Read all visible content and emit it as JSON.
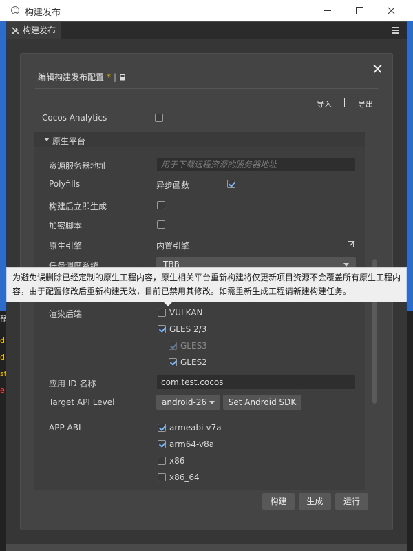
{
  "window": {
    "title": "构建发布",
    "tab_label": "构建发布"
  },
  "background_peek": {
    "left": [
      "d",
      "d",
      "st",
      "e"
    ],
    "left_top_char": "琵",
    "right_top_char": "a"
  },
  "dialog": {
    "title": "编辑构建发布配置",
    "modified_marker": "*",
    "separator": "|",
    "import_label": "导入",
    "export_label": "导出"
  },
  "cocos_analytics": {
    "label": "Cocos Analytics",
    "checked": false
  },
  "native_section": {
    "title": "原生平台",
    "resource_server": {
      "label": "资源服务器地址",
      "placeholder": "用于下载远程资源的服务器地址"
    },
    "polyfills": {
      "label": "Polyfills",
      "option_label": "异步函数",
      "checked": true
    },
    "build_immediately": {
      "label": "构建后立即生成",
      "checked": false
    },
    "encrypt_script": {
      "label": "加密脚本",
      "checked": false
    },
    "native_engine": {
      "label": "原生引擎",
      "value": "内置引擎"
    },
    "task_scheduler": {
      "label": "任务调度系统",
      "value": "TBB"
    },
    "render_backend": {
      "label": "渲染后端",
      "options": [
        {
          "label": "VULKAN",
          "checked": false
        },
        {
          "label": "GLES 2/3",
          "checked": true
        },
        {
          "label": "GLES3",
          "checked": true,
          "disabled": true
        },
        {
          "label": "GLES2",
          "checked": true
        }
      ]
    },
    "app_id": {
      "label": "应用 ID 名称",
      "value": "com.test.cocos"
    },
    "target_api": {
      "label": "Target API Level",
      "value": "android-26",
      "sdk_button": "Set Android SDK"
    },
    "app_abi": {
      "label": "APP ABI",
      "options": [
        {
          "label": "armeabi-v7a",
          "checked": true
        },
        {
          "label": "arm64-v8a",
          "checked": true
        },
        {
          "label": "x86",
          "checked": false
        },
        {
          "label": "x86_64",
          "checked": false
        }
      ]
    }
  },
  "footer": {
    "build": "构建",
    "make": "生成",
    "run": "运行"
  },
  "tooltip": {
    "text": "为避免误删除已经定制的原生工程内容，原生相关平台重新构建将仅更新项目资源不会覆盖所有原生工程内容，由于配置修改后重新构建无效，目前已禁用其修改。如需重新生成工程请新建构建任务。"
  }
}
